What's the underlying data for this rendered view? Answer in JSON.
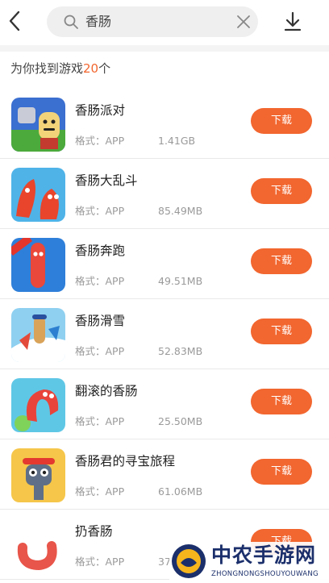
{
  "header": {
    "search_query": "香肠",
    "icons": {
      "back": "chevron-left-icon",
      "search": "search-icon",
      "clear": "close-icon",
      "download": "download-icon"
    }
  },
  "summary": {
    "prefix": "为你找到游戏",
    "count": "20",
    "suffix": "个"
  },
  "accent_color": "#f2662f",
  "games": [
    {
      "name": "香肠派对",
      "format": "格式：APP",
      "size": "1.41GB",
      "button": "下载"
    },
    {
      "name": "香肠大乱斗",
      "format": "格式：APP",
      "size": "85.49MB",
      "button": "下载"
    },
    {
      "name": "香肠奔跑",
      "format": "格式：APP",
      "size": "49.51MB",
      "button": "下载"
    },
    {
      "name": "香肠滑雪",
      "format": "格式：APP",
      "size": "52.83MB",
      "button": "下载"
    },
    {
      "name": "翻滚的香肠",
      "format": "格式：APP",
      "size": "25.50MB",
      "button": "下载"
    },
    {
      "name": "香肠君的寻宝旅程",
      "format": "格式：APP",
      "size": "61.06MB",
      "button": "下载"
    },
    {
      "name": "扔香肠",
      "format": "格式：APP",
      "size": "37",
      "button": "下载"
    }
  ],
  "watermark": {
    "name": "中农手游网",
    "site": "ZHONGNONGSHOUYOUWANG"
  }
}
